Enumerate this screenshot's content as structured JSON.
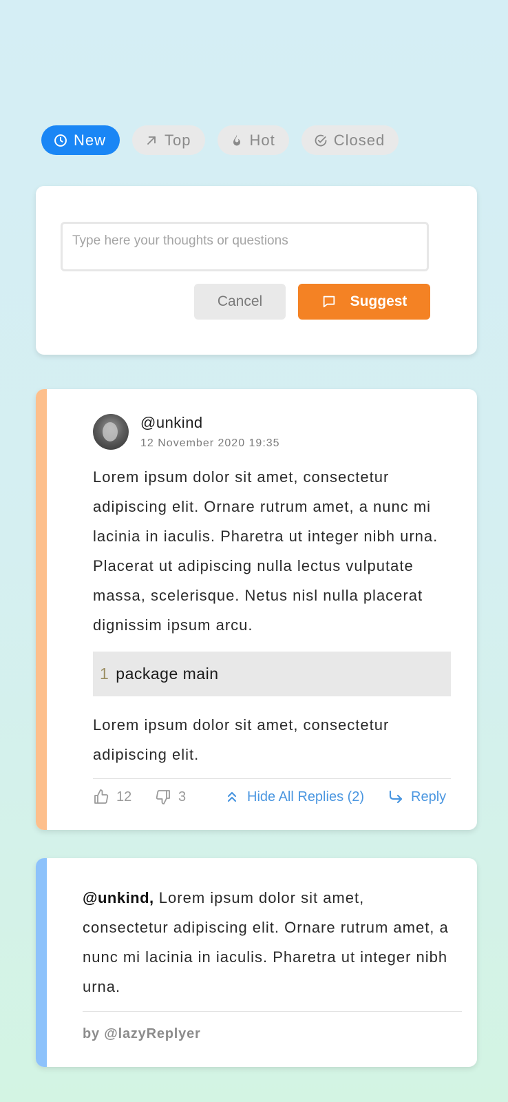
{
  "filters": [
    {
      "label": "New",
      "icon": "clock-icon",
      "active": true
    },
    {
      "label": "Top",
      "icon": "arrow-up-right-icon",
      "active": false
    },
    {
      "label": "Hot",
      "icon": "flame-icon",
      "active": false
    },
    {
      "label": "Closed",
      "icon": "check-circle-icon",
      "active": false
    }
  ],
  "composer": {
    "placeholder": "Type here your thoughts or questions",
    "cancel_label": "Cancel",
    "suggest_label": "Suggest"
  },
  "comment": {
    "username": "@unkind",
    "timestamp": "12 November 2020 19:35",
    "paragraph1": "Lorem ipsum dolor sit amet, consectetur adipiscing elit. Ornare rutrum amet, a nunc mi lacinia in iaculis. Pharetra ut integer nibh urna. Placerat ut adipiscing nulla lectus vulputate massa, scelerisque. Netus nisl nulla placerat dignissim ipsum arcu.",
    "code": {
      "line_number": "1",
      "text": "package main"
    },
    "paragraph2": "Lorem ipsum dolor sit amet, consectetur adipiscing elit.",
    "likes": "12",
    "dislikes": "3",
    "hide_replies_label": "Hide All Replies (2)",
    "reply_label": "Reply"
  },
  "reply": {
    "mention": "@unkind,",
    "text": " Lorem ipsum dolor sit amet, consectetur adipiscing elit. Ornare rutrum amet, a nunc mi lacinia in iaculis. Pharetra ut integer nibh urna.",
    "by": "by @lazyReplyer"
  },
  "colors": {
    "accent_blue": "#1a86f5",
    "suggest_orange": "#f48224",
    "comment_bar": "#fdbf8c",
    "reply_bar": "#8dc2fb",
    "link_blue": "#4a96e0"
  }
}
